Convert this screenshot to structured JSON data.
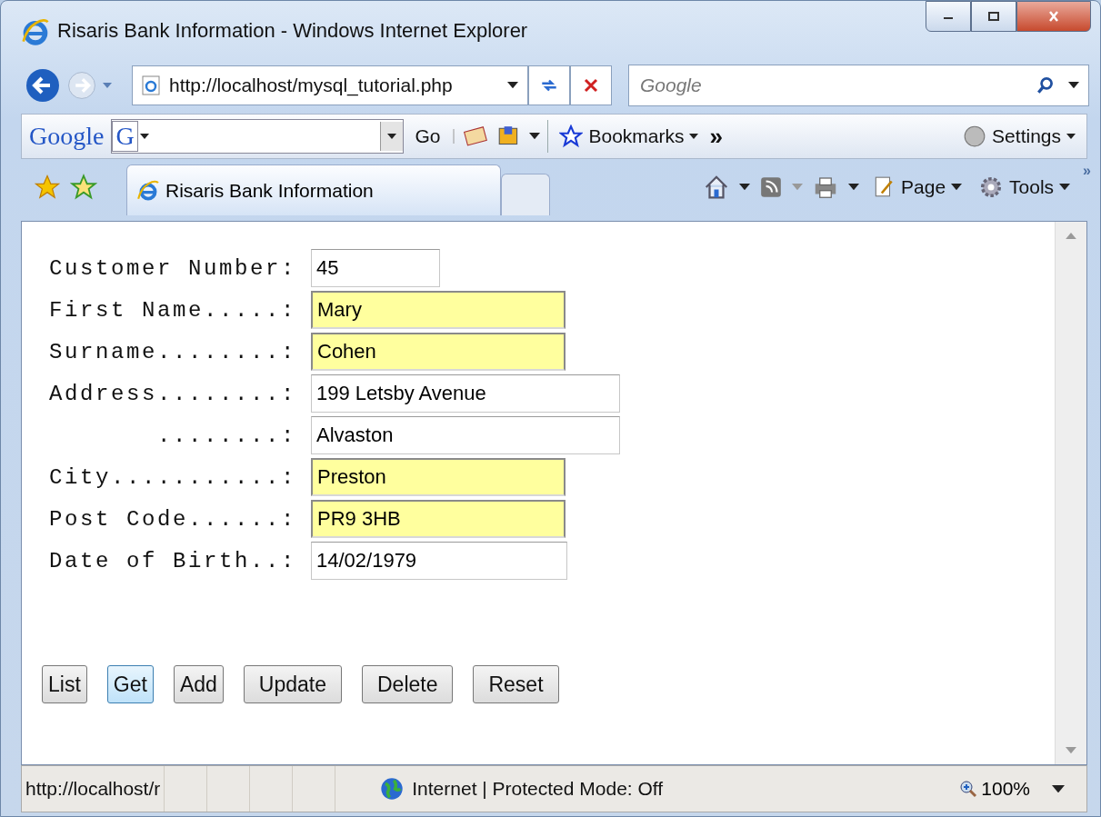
{
  "window": {
    "title": "Risaris Bank Information - Windows Internet Explorer"
  },
  "address_bar": {
    "url": "http://localhost/mysql_tutorial.php"
  },
  "search": {
    "placeholder": "Google"
  },
  "google_toolbar": {
    "logo": "Google",
    "badge": "G",
    "go": "Go",
    "bookmarks": "Bookmarks",
    "more": "»",
    "settings": "Settings"
  },
  "tabs": [
    {
      "label": "Risaris Bank Information",
      "selected": true
    }
  ],
  "command_bar": {
    "items": [
      {
        "label": "Page"
      },
      {
        "label": "Tools"
      }
    ],
    "more": "»"
  },
  "form": {
    "fields": [
      {
        "label": "Customer Number:",
        "value": "45",
        "highlighted": false
      },
      {
        "label": "First Name.....:",
        "value": "Mary",
        "highlighted": true
      },
      {
        "label": "Surname........:",
        "value": "Cohen",
        "highlighted": true
      },
      {
        "label": "Address........:",
        "value": "199 Letsby Avenue",
        "highlighted": false
      },
      {
        "label": "........:",
        "value": "Alvaston",
        "highlighted": false
      },
      {
        "label": "City...........:",
        "value": "Preston",
        "highlighted": true
      },
      {
        "label": "Post Code......:",
        "value": "PR9 3HB",
        "highlighted": true
      },
      {
        "label": "Date of Birth..:",
        "value": "14/02/1979",
        "highlighted": false
      }
    ],
    "buttons": [
      {
        "label": "List",
        "focused": false
      },
      {
        "label": "Get",
        "focused": true
      },
      {
        "label": "Add",
        "focused": false
      },
      {
        "label": "Update",
        "focused": false
      },
      {
        "label": "Delete",
        "focused": false
      },
      {
        "label": "Reset",
        "focused": false
      }
    ]
  },
  "status_bar": {
    "url": "http://localhost/r",
    "zone": "Internet | Protected Mode: Off",
    "zoom": "100%"
  }
}
